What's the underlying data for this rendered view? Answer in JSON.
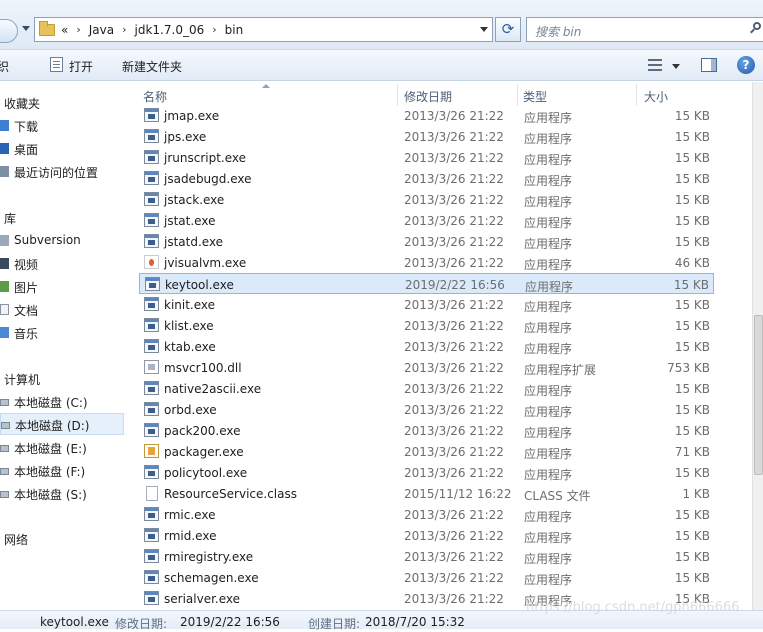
{
  "address": {
    "breadcrumbs": [
      "«",
      "Java",
      "jdk1.7.0_06",
      "bin"
    ],
    "search_placeholder": "搜索 bin"
  },
  "toolbar": {
    "edge_label": "织",
    "open_label": "打开",
    "new_folder_label": "新建文件夹"
  },
  "sidebar": {
    "items": [
      {
        "label": "收藏夹",
        "group": true
      },
      {
        "label": "下载"
      },
      {
        "label": "桌面"
      },
      {
        "label": "最近访问的位置"
      },
      {
        "label": "库",
        "group": true
      },
      {
        "label": "Subversion"
      },
      {
        "label": "视频"
      },
      {
        "label": "图片"
      },
      {
        "label": "文档"
      },
      {
        "label": "音乐"
      },
      {
        "label": "计算机",
        "group": true
      },
      {
        "label": "本地磁盘 (C:)"
      },
      {
        "label": "本地磁盘 (D:)",
        "selected": true
      },
      {
        "label": "本地磁盘 (E:)"
      },
      {
        "label": "本地磁盘 (F:)"
      },
      {
        "label": "本地磁盘 (S:)"
      },
      {
        "label": "网络",
        "group": true
      }
    ]
  },
  "columns": [
    "名称",
    "修改日期",
    "类型",
    "大小"
  ],
  "files": [
    {
      "name": "jmap.exe",
      "date": "2013/3/26 21:22",
      "type": "应用程序",
      "size": "15 KB",
      "icon": "exe-icon"
    },
    {
      "name": "jps.exe",
      "date": "2013/3/26 21:22",
      "type": "应用程序",
      "size": "15 KB",
      "icon": "exe-icon"
    },
    {
      "name": "jrunscript.exe",
      "date": "2013/3/26 21:22",
      "type": "应用程序",
      "size": "15 KB",
      "icon": "exe-icon"
    },
    {
      "name": "jsadebugd.exe",
      "date": "2013/3/26 21:22",
      "type": "应用程序",
      "size": "15 KB",
      "icon": "exe-icon"
    },
    {
      "name": "jstack.exe",
      "date": "2013/3/26 21:22",
      "type": "应用程序",
      "size": "15 KB",
      "icon": "exe-icon"
    },
    {
      "name": "jstat.exe",
      "date": "2013/3/26 21:22",
      "type": "应用程序",
      "size": "15 KB",
      "icon": "exe-icon"
    },
    {
      "name": "jstatd.exe",
      "date": "2013/3/26 21:22",
      "type": "应用程序",
      "size": "15 KB",
      "icon": "exe-icon"
    },
    {
      "name": "jvisualvm.exe",
      "date": "2013/3/26 21:22",
      "type": "应用程序",
      "size": "46 KB",
      "icon": "visualvm-icon"
    },
    {
      "name": "keytool.exe",
      "date": "2019/2/22 16:56",
      "type": "应用程序",
      "size": "15 KB",
      "icon": "exe-icon",
      "selected": true
    },
    {
      "name": "kinit.exe",
      "date": "2013/3/26 21:22",
      "type": "应用程序",
      "size": "15 KB",
      "icon": "exe-icon"
    },
    {
      "name": "klist.exe",
      "date": "2013/3/26 21:22",
      "type": "应用程序",
      "size": "15 KB",
      "icon": "exe-icon"
    },
    {
      "name": "ktab.exe",
      "date": "2013/3/26 21:22",
      "type": "应用程序",
      "size": "15 KB",
      "icon": "exe-icon"
    },
    {
      "name": "msvcr100.dll",
      "date": "2013/3/26 21:22",
      "type": "应用程序扩展",
      "size": "753 KB",
      "icon": "dll-icon"
    },
    {
      "name": "native2ascii.exe",
      "date": "2013/3/26 21:22",
      "type": "应用程序",
      "size": "15 KB",
      "icon": "exe-icon"
    },
    {
      "name": "orbd.exe",
      "date": "2013/3/26 21:22",
      "type": "应用程序",
      "size": "15 KB",
      "icon": "exe-icon"
    },
    {
      "name": "pack200.exe",
      "date": "2013/3/26 21:22",
      "type": "应用程序",
      "size": "15 KB",
      "icon": "exe-icon"
    },
    {
      "name": "packager.exe",
      "date": "2013/3/26 21:22",
      "type": "应用程序",
      "size": "71 KB",
      "icon": "packager-icon"
    },
    {
      "name": "policytool.exe",
      "date": "2013/3/26 21:22",
      "type": "应用程序",
      "size": "15 KB",
      "icon": "exe-icon"
    },
    {
      "name": "ResourceService.class",
      "date": "2015/11/12 16:22",
      "type": "CLASS 文件",
      "size": "1 KB",
      "icon": "class-file-icon"
    },
    {
      "name": "rmic.exe",
      "date": "2013/3/26 21:22",
      "type": "应用程序",
      "size": "15 KB",
      "icon": "exe-icon"
    },
    {
      "name": "rmid.exe",
      "date": "2013/3/26 21:22",
      "type": "应用程序",
      "size": "15 KB",
      "icon": "exe-icon"
    },
    {
      "name": "rmiregistry.exe",
      "date": "2013/3/26 21:22",
      "type": "应用程序",
      "size": "15 KB",
      "icon": "exe-icon"
    },
    {
      "name": "schemagen.exe",
      "date": "2013/3/26 21:22",
      "type": "应用程序",
      "size": "15 KB",
      "icon": "exe-icon"
    },
    {
      "name": "serialver.exe",
      "date": "2013/3/26 21:22",
      "type": "应用程序",
      "size": "15 KB",
      "icon": "exe-icon"
    }
  ],
  "status": {
    "filename": "keytool.exe",
    "modified_label": "修改日期:",
    "modified_value": "2019/2/22 16:56",
    "created_label": "创建日期:",
    "created_value": "2018/7/20 15:32"
  },
  "watermark": "https://blog.csdn.net/gph666666"
}
